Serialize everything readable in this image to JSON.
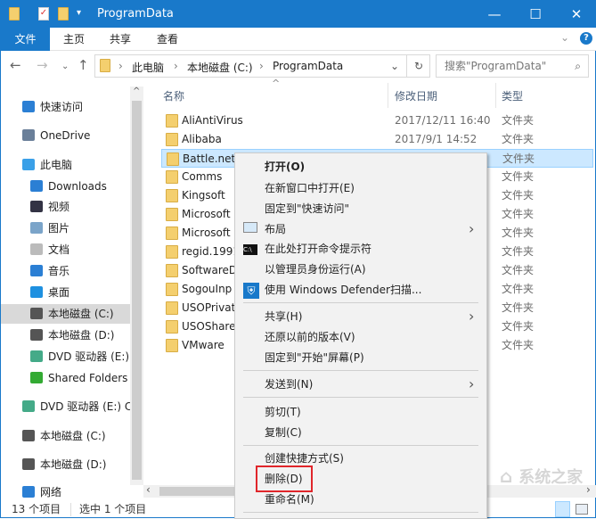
{
  "window": {
    "title": "ProgramData",
    "minimize": "—",
    "maximize": "☐",
    "close": "✕"
  },
  "ribbon": {
    "tabs": [
      "文件",
      "主页",
      "共享",
      "查看"
    ],
    "expand": "⌄",
    "help": "?"
  },
  "address": {
    "crumbs": [
      "此电脑",
      "本地磁盘 (C:)",
      "ProgramData"
    ],
    "sep": "›",
    "refresh": "↻",
    "dropdown": "⌄"
  },
  "search": {
    "placeholder": "搜索\"ProgramData\"",
    "icon": "⌕"
  },
  "nav": {
    "back": "←",
    "forward": "→",
    "recent": "⌄",
    "up": "↑"
  },
  "columns": {
    "name": "名称",
    "date": "修改日期",
    "type": "类型",
    "sort": "^"
  },
  "files": [
    {
      "name": "AliAntiVirus",
      "date": "2017/12/11 16:40",
      "type": "文件夹"
    },
    {
      "name": "Alibaba",
      "date": "2017/9/1 14:52",
      "type": "文件夹"
    },
    {
      "name": "Battle.net",
      "date": "",
      "type": "文件夹",
      "selected": true
    },
    {
      "name": "Comms",
      "date": "",
      "type": "文件夹"
    },
    {
      "name": "Kingsoft",
      "date": "",
      "type": "文件夹"
    },
    {
      "name": "Microsoft",
      "date": "",
      "type": "文件夹"
    },
    {
      "name": "Microsoft",
      "date": "",
      "type": "文件夹"
    },
    {
      "name": "regid.1991",
      "date": "",
      "type": "文件夹"
    },
    {
      "name": "SoftwareD",
      "date": "",
      "type": "文件夹"
    },
    {
      "name": "SogouInp",
      "date": "",
      "type": "文件夹"
    },
    {
      "name": "USOPrivat",
      "date": "",
      "type": "文件夹"
    },
    {
      "name": "USOShare",
      "date": "",
      "type": "文件夹"
    },
    {
      "name": "VMware",
      "date": "",
      "type": "文件夹"
    }
  ],
  "sidebar": [
    {
      "label": "快速访问",
      "icon": "star-icon",
      "indent": 0,
      "color": "#2b7fd4"
    },
    {
      "label": "OneDrive",
      "icon": "onedrive-icon",
      "indent": 0,
      "color": "#6a7f99"
    },
    {
      "label": "此电脑",
      "icon": "computer-icon",
      "indent": 0,
      "color": "#3aa0e8"
    },
    {
      "label": "Downloads",
      "icon": "download-icon",
      "indent": 1,
      "color": "#2b7fd4"
    },
    {
      "label": "视频",
      "icon": "video-icon",
      "indent": 1,
      "color": "#334"
    },
    {
      "label": "图片",
      "icon": "pictures-icon",
      "indent": 1,
      "color": "#7ba4c9"
    },
    {
      "label": "文档",
      "icon": "documents-icon",
      "indent": 1,
      "color": "#bbb"
    },
    {
      "label": "音乐",
      "icon": "music-icon",
      "indent": 1,
      "color": "#2b7fd4"
    },
    {
      "label": "桌面",
      "icon": "desktop-icon",
      "indent": 1,
      "color": "#1e90e0"
    },
    {
      "label": "本地磁盘 (C:)",
      "icon": "drive-c-icon",
      "indent": 1,
      "color": "#555",
      "selected": true
    },
    {
      "label": "本地磁盘 (D:)",
      "icon": "drive-icon",
      "indent": 1,
      "color": "#555"
    },
    {
      "label": "DVD 驱动器 (E:)",
      "icon": "dvd-icon",
      "indent": 1,
      "color": "#4a8"
    },
    {
      "label": "Shared Folders",
      "icon": "shared-folders-icon",
      "indent": 1,
      "color": "#3a3"
    },
    {
      "label": "DVD 驱动器 (E:) C",
      "icon": "dvd-icon",
      "indent": 0,
      "color": "#4a8"
    },
    {
      "label": "本地磁盘 (C:)",
      "icon": "drive-c-icon",
      "indent": 0,
      "color": "#555"
    },
    {
      "label": "本地磁盘 (D:)",
      "icon": "drive-icon",
      "indent": 0,
      "color": "#555"
    },
    {
      "label": "网络",
      "icon": "network-icon",
      "indent": 0,
      "color": "#2b7fd4"
    }
  ],
  "status": {
    "count": "13 个项目",
    "selected": "选中 1 个项目"
  },
  "context_menu": [
    {
      "label": "打开(O)",
      "bold": true
    },
    {
      "label": "在新窗口中打开(E)"
    },
    {
      "label": "固定到\"快速访问\""
    },
    {
      "label": "布局",
      "icon": "layout-icon",
      "submenu": true
    },
    {
      "label": "在此处打开命令提示符",
      "icon": "cmd-icon"
    },
    {
      "label": "以管理员身份运行(A)"
    },
    {
      "label": "使用 Windows Defender扫描...",
      "icon": "defender-shield-icon"
    },
    {
      "label": "共享(H)",
      "submenu": true
    },
    {
      "label": "还原以前的版本(V)"
    },
    {
      "label": "固定到\"开始\"屏幕(P)"
    },
    {
      "label": "发送到(N)",
      "submenu": true
    },
    {
      "label": "剪切(T)"
    },
    {
      "label": "复制(C)"
    },
    {
      "label": "创建快捷方式(S)"
    },
    {
      "label": "删除(D)",
      "highlighted": true
    },
    {
      "label": "重命名(M)"
    }
  ],
  "submenu_arrow": "›",
  "watermark": "系统之家",
  "colors": {
    "accent": "#1979ca",
    "selection": "#cce8ff",
    "highlight_box": "#e0262b"
  }
}
